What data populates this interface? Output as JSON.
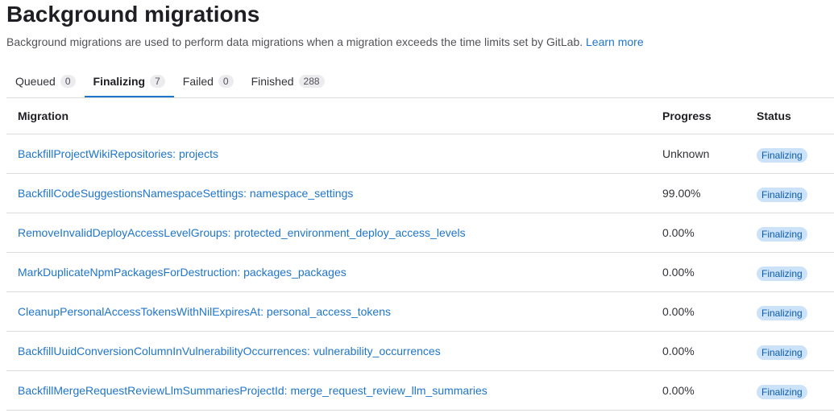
{
  "title": "Background migrations",
  "description": "Background migrations are used to perform data migrations when a migration exceeds the time limits set by GitLab.",
  "learn_more": "Learn more",
  "tabs": [
    {
      "label": "Queued",
      "count": "0"
    },
    {
      "label": "Finalizing",
      "count": "7"
    },
    {
      "label": "Failed",
      "count": "0"
    },
    {
      "label": "Finished",
      "count": "288"
    }
  ],
  "columns": {
    "migration": "Migration",
    "progress": "Progress",
    "status": "Status"
  },
  "rows": [
    {
      "name": "BackfillProjectWikiRepositories: projects",
      "progress": "Unknown",
      "status": "Finalizing"
    },
    {
      "name": "BackfillCodeSuggestionsNamespaceSettings: namespace_settings",
      "progress": "99.00%",
      "status": "Finalizing"
    },
    {
      "name": "RemoveInvalidDeployAccessLevelGroups: protected_environment_deploy_access_levels",
      "progress": "0.00%",
      "status": "Finalizing"
    },
    {
      "name": "MarkDuplicateNpmPackagesForDestruction: packages_packages",
      "progress": "0.00%",
      "status": "Finalizing"
    },
    {
      "name": "CleanupPersonalAccessTokensWithNilExpiresAt: personal_access_tokens",
      "progress": "0.00%",
      "status": "Finalizing"
    },
    {
      "name": "BackfillUuidConversionColumnInVulnerabilityOccurrences: vulnerability_occurrences",
      "progress": "0.00%",
      "status": "Finalizing"
    },
    {
      "name": "BackfillMergeRequestReviewLlmSummariesProjectId: merge_request_review_llm_summaries",
      "progress": "0.00%",
      "status": "Finalizing"
    }
  ]
}
